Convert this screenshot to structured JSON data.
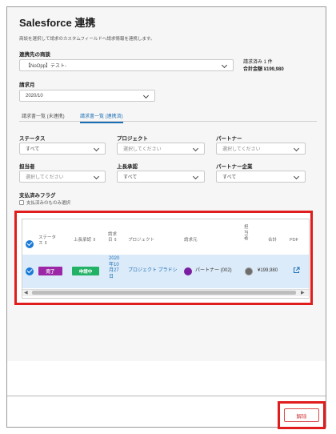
{
  "header": {
    "title": "Salesforce 連携",
    "description": "商談を選択して請求のカスタムフィールドへ請求情報を連携します。"
  },
  "opportunity": {
    "label": "連携先の商談",
    "value": "【NoOpp】テスト-",
    "summary_line1": "請求済み 1 件",
    "summary_line2": "合計金額 ¥199,980"
  },
  "billing_month": {
    "label": "請求月",
    "value": "2020/10"
  },
  "tabs": [
    {
      "label": "請求書一覧 (未連携)"
    },
    {
      "label": "請求書一覧 (連携済)"
    }
  ],
  "filters": {
    "status": {
      "label": "ステータス",
      "value": "すべて"
    },
    "project": {
      "label": "プロジェクト",
      "placeholder": "選択してください"
    },
    "partner": {
      "label": "パートナー",
      "placeholder": "選択してください"
    },
    "assignee": {
      "label": "担当者",
      "placeholder": "選択してください"
    },
    "approver": {
      "label": "上長承認",
      "value": "すべて"
    },
    "partner_company": {
      "label": "パートナー企業",
      "value": "すべて"
    },
    "paid_flag": {
      "label": "支払済みフラグ",
      "option": "支払済みのものみ選択"
    }
  },
  "table": {
    "headers": {
      "status": [
        "ステータ",
        "ス ⇕"
      ],
      "approval": "上長承認 ⇕",
      "date": [
        "請求",
        "日 ⇕"
      ],
      "project": "プロジェクト",
      "billing": "請求元",
      "assignee": [
        "担",
        "当",
        "者"
      ],
      "total": "合計",
      "pdf": "PDF"
    },
    "rows": [
      {
        "status_badge": "完了",
        "approval_badge": "申請中",
        "date_lines": [
          "2020",
          "年10",
          "月27",
          "日"
        ],
        "project": "プロジェクト プラドシ",
        "billing_from": "パートナー (002)",
        "total": "¥199,980"
      }
    ]
  },
  "footer": {
    "release_label": "解除"
  },
  "colors": {
    "status_badge": "#9c27a6",
    "approval_badge": "#21b266",
    "accent": "#1d6fb5",
    "highlight_box": "#e01c1c"
  }
}
